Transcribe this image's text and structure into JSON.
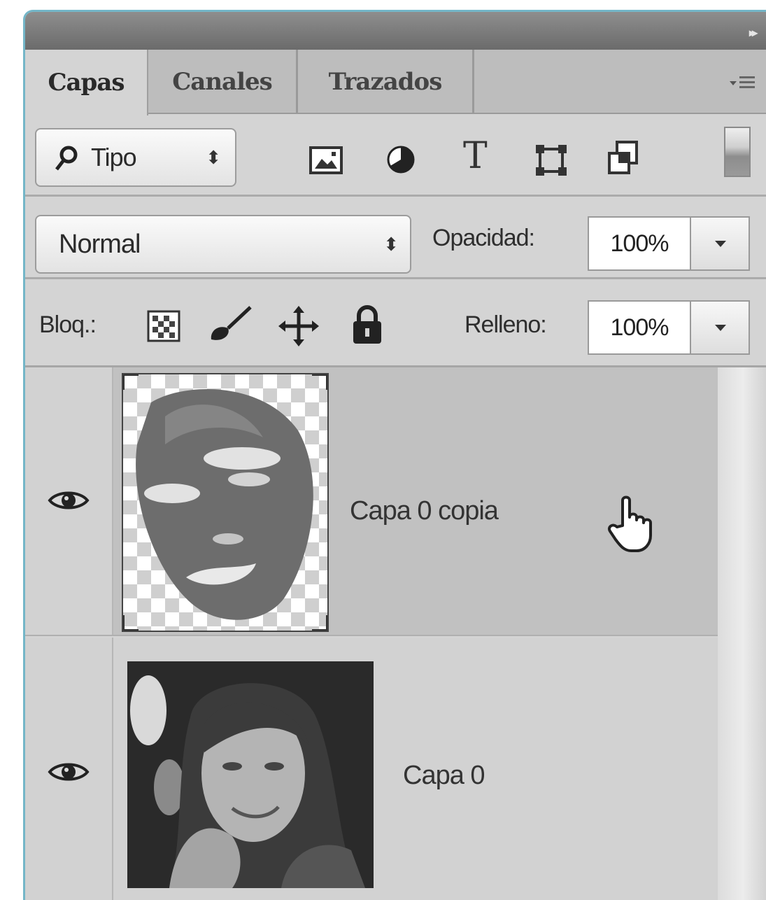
{
  "panel": {
    "collapse_glyph": "▸▸",
    "tabs": [
      {
        "label": "Capas",
        "active": true
      },
      {
        "label": "Canales",
        "active": false
      },
      {
        "label": "Trazados",
        "active": false
      }
    ]
  },
  "filter": {
    "kind_label": "Tipo",
    "icons": [
      "image-filter-icon",
      "adjustment-filter-icon",
      "type-filter-icon",
      "shape-filter-icon",
      "smart-object-filter-icon"
    ],
    "type_glyph": "T"
  },
  "blend": {
    "mode": "Normal",
    "opacity_label": "Opacidad:",
    "opacity_value": "100%"
  },
  "lock": {
    "label": "Bloq.:",
    "icons": [
      "lock-transparent-icon",
      "lock-image-icon",
      "lock-position-icon",
      "lock-all-icon"
    ],
    "fill_label": "Relleno:",
    "fill_value": "100%"
  },
  "layers": [
    {
      "name": "Capa 0 copia",
      "visible": true,
      "selected": true
    },
    {
      "name": "Capa 0",
      "visible": true,
      "selected": false
    }
  ],
  "colors": {
    "panel_border": "#74b6c8",
    "panel_bg": "#d4d4d4",
    "selected_row": "#c1c1c1"
  }
}
